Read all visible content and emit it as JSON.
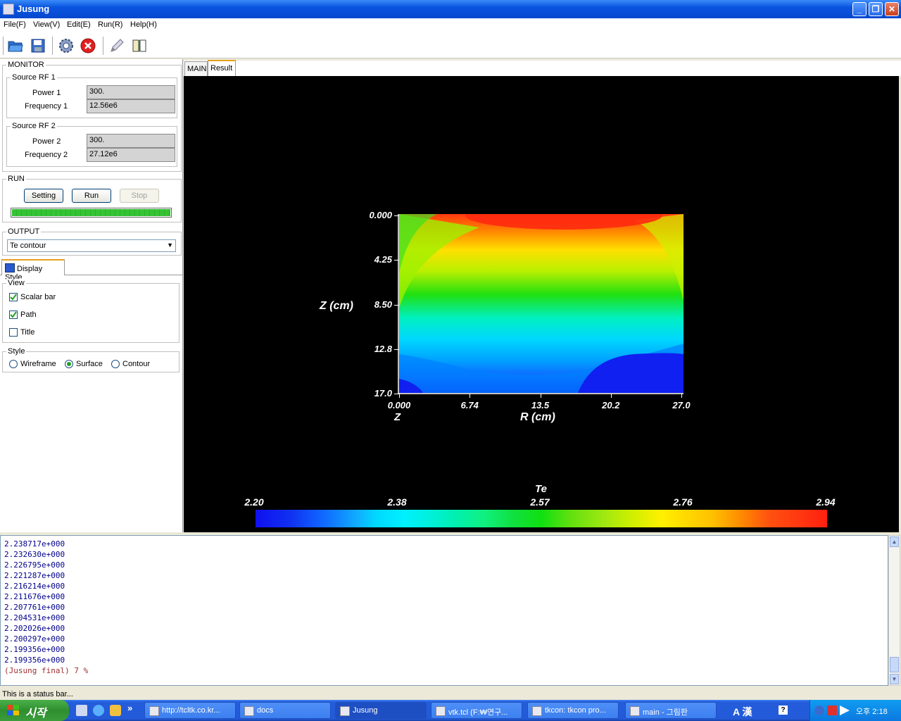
{
  "window": {
    "title": "Jusung"
  },
  "menu": [
    "File(F)",
    "View(V)",
    "Edit(E)",
    "Run(R)",
    "Help(H)"
  ],
  "toolbar": {
    "icons": [
      "open-folder-icon",
      "save-disk-icon",
      "settings-gear-icon",
      "stop-x-icon",
      "pencil-icon",
      "book-icon"
    ]
  },
  "monitor": {
    "label": "MONITOR",
    "rf1": {
      "label": "Source RF 1",
      "power_label": "Power 1",
      "power": "300.",
      "freq_label": "Frequency 1",
      "freq": "12.56e6"
    },
    "rf2": {
      "label": "Source RF 2",
      "power_label": "Power 2",
      "power": "300.",
      "freq_label": "Frequency 2",
      "freq": "27.12e6"
    }
  },
  "run": {
    "label": "RUN",
    "setting": "Setting",
    "run": "Run",
    "stop": "Stop",
    "progress": 1.0
  },
  "output": {
    "label": "OUTPUT",
    "selected": "Te contour"
  },
  "display_style": {
    "tab": "Display Style",
    "view_label": "View",
    "scalar_bar": {
      "label": "Scalar bar",
      "checked": true
    },
    "path": {
      "label": "Path",
      "checked": true
    },
    "title": {
      "label": "Title",
      "checked": false
    },
    "style_label": "Style",
    "wireframe": "Wireframe",
    "surface": "Surface",
    "contour": "Contour",
    "selected_style": "Surface"
  },
  "tabs": [
    "MAIN",
    "Result"
  ],
  "active_tab": "Result",
  "chart_data": {
    "type": "heatmap",
    "xlabel": "R (cm)",
    "ylabel": "Z (cm)",
    "corner_label": "Z",
    "xticks": [
      "0.000",
      "6.74",
      "13.5",
      "20.2",
      "27.0"
    ],
    "yticks": [
      "0.000",
      "4.25",
      "8.50",
      "12.8",
      "17.0"
    ],
    "xlim": [
      0,
      27.0
    ],
    "ylim": [
      0,
      17.0
    ],
    "scalar_bar": {
      "title": "Te",
      "ticks": [
        "2.20",
        "2.38",
        "2.57",
        "2.76",
        "2.94"
      ],
      "range": [
        2.2,
        2.94
      ]
    }
  },
  "console": {
    "lines": [
      "2.238717e+000",
      "2.232630e+000",
      "2.226795e+000",
      "2.221287e+000",
      "2.216214e+000",
      "2.211676e+000",
      "2.207761e+000",
      "2.204531e+000",
      "2.202026e+000",
      "2.200297e+000",
      "2.199356e+000",
      "2.199356e+000"
    ],
    "final": "(Jusung final) 7 %"
  },
  "status": "This is a status bar...",
  "taskbar": {
    "start": "시작",
    "tasks": [
      {
        "label": "http://tcltk.co.kr...",
        "icon": "browser-icon"
      },
      {
        "label": "docs",
        "icon": "folder-icon"
      },
      {
        "label": "Jusung",
        "icon": "app-icon"
      },
      {
        "label": "vtk.tcl (F:₩연구...",
        "icon": "editor-icon"
      },
      {
        "label": "tkcon: tkcon pro...",
        "icon": "console-icon"
      },
      {
        "label": "main - 그림판",
        "icon": "paint-icon"
      }
    ],
    "ime": "A 漢",
    "time": "오후 2:18"
  }
}
